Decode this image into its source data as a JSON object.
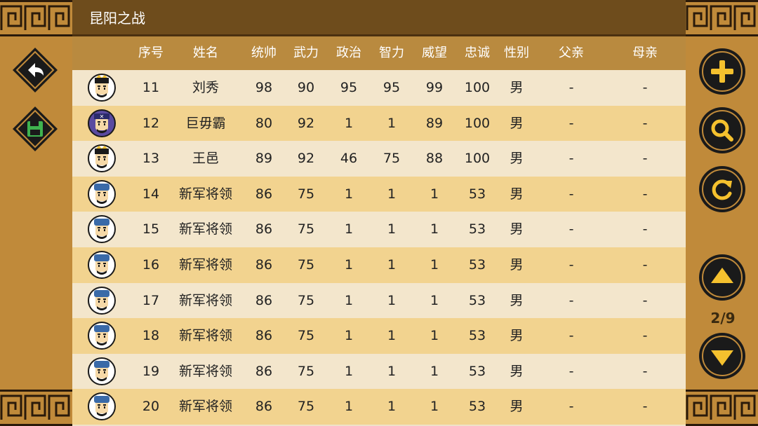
{
  "title": "昆阳之战",
  "columns": [
    "序号",
    "姓名",
    "统帅",
    "武力",
    "政治",
    "智力",
    "威望",
    "忠诚",
    "性别",
    "父亲",
    "母亲"
  ],
  "rows": [
    {
      "id": "11",
      "name": "刘秀",
      "lead": "98",
      "war": "90",
      "pol": "95",
      "int": "95",
      "fame": "99",
      "loyal": "100",
      "gender": "男",
      "father": "-",
      "mother": "-",
      "face": "king"
    },
    {
      "id": "12",
      "name": "巨毋霸",
      "lead": "80",
      "war": "92",
      "pol": "1",
      "int": "1",
      "fame": "89",
      "loyal": "100",
      "gender": "男",
      "father": "-",
      "mother": "-",
      "face": "giant"
    },
    {
      "id": "13",
      "name": "王邑",
      "lead": "89",
      "war": "92",
      "pol": "46",
      "int": "75",
      "fame": "88",
      "loyal": "100",
      "gender": "男",
      "father": "-",
      "mother": "-",
      "face": "king"
    },
    {
      "id": "14",
      "name": "新军将领",
      "lead": "86",
      "war": "75",
      "pol": "1",
      "int": "1",
      "fame": "1",
      "loyal": "53",
      "gender": "男",
      "father": "-",
      "mother": "-",
      "face": "soldier"
    },
    {
      "id": "15",
      "name": "新军将领",
      "lead": "86",
      "war": "75",
      "pol": "1",
      "int": "1",
      "fame": "1",
      "loyal": "53",
      "gender": "男",
      "father": "-",
      "mother": "-",
      "face": "soldier"
    },
    {
      "id": "16",
      "name": "新军将领",
      "lead": "86",
      "war": "75",
      "pol": "1",
      "int": "1",
      "fame": "1",
      "loyal": "53",
      "gender": "男",
      "father": "-",
      "mother": "-",
      "face": "soldier"
    },
    {
      "id": "17",
      "name": "新军将领",
      "lead": "86",
      "war": "75",
      "pol": "1",
      "int": "1",
      "fame": "1",
      "loyal": "53",
      "gender": "男",
      "father": "-",
      "mother": "-",
      "face": "soldier"
    },
    {
      "id": "18",
      "name": "新军将领",
      "lead": "86",
      "war": "75",
      "pol": "1",
      "int": "1",
      "fame": "1",
      "loyal": "53",
      "gender": "男",
      "father": "-",
      "mother": "-",
      "face": "soldier"
    },
    {
      "id": "19",
      "name": "新军将领",
      "lead": "86",
      "war": "75",
      "pol": "1",
      "int": "1",
      "fame": "1",
      "loyal": "53",
      "gender": "男",
      "father": "-",
      "mother": "-",
      "face": "soldier"
    },
    {
      "id": "20",
      "name": "新军将领",
      "lead": "86",
      "war": "75",
      "pol": "1",
      "int": "1",
      "fame": "1",
      "loyal": "53",
      "gender": "男",
      "father": "-",
      "mother": "-",
      "face": "soldier"
    }
  ],
  "page": "2/9",
  "icons": {
    "back": "back-arrow-icon",
    "save": "floppy-disk-icon",
    "add": "plus-icon",
    "search": "magnifier-icon",
    "refresh": "refresh-icon",
    "up": "triangle-up-icon",
    "down": "triangle-down-icon"
  },
  "colors": {
    "title_bar": "#6e4c1c",
    "header_row": "#b98a3f",
    "row_light": "#f3e6cc",
    "row_dark": "#f2d38f",
    "side_panel": "#c08a3a",
    "button_dark": "#1a1a1a",
    "button_icon": "#f5c12e",
    "save_icon": "#3fb34f"
  }
}
